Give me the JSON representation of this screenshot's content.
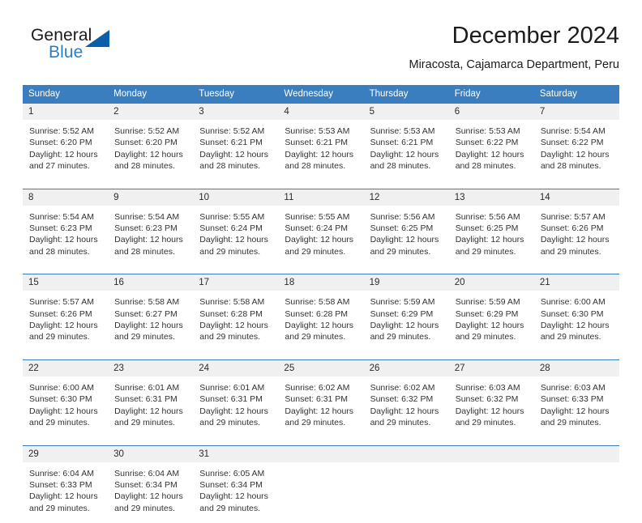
{
  "brand": {
    "name_part1": "General",
    "name_part2": "Blue",
    "flag_icon": "triangle-flag-icon"
  },
  "header": {
    "title": "December 2024",
    "subtitle": "Miracosta, Cajamarca Department, Peru"
  },
  "colors": {
    "header_blue": "#3a7ebf",
    "brand_blue": "#2e7cc4",
    "flag_blue": "#0d5ea8",
    "daynum_band": "#f0f0f0",
    "text": "#333333"
  },
  "calendar": {
    "day_headers": [
      "Sunday",
      "Monday",
      "Tuesday",
      "Wednesday",
      "Thursday",
      "Friday",
      "Saturday"
    ],
    "weeks": [
      [
        {
          "day": "1",
          "sunrise": "Sunrise: 5:52 AM",
          "sunset": "Sunset: 6:20 PM",
          "daylight_line1": "Daylight: 12 hours",
          "daylight_line2": "and 27 minutes."
        },
        {
          "day": "2",
          "sunrise": "Sunrise: 5:52 AM",
          "sunset": "Sunset: 6:20 PM",
          "daylight_line1": "Daylight: 12 hours",
          "daylight_line2": "and 28 minutes."
        },
        {
          "day": "3",
          "sunrise": "Sunrise: 5:52 AM",
          "sunset": "Sunset: 6:21 PM",
          "daylight_line1": "Daylight: 12 hours",
          "daylight_line2": "and 28 minutes."
        },
        {
          "day": "4",
          "sunrise": "Sunrise: 5:53 AM",
          "sunset": "Sunset: 6:21 PM",
          "daylight_line1": "Daylight: 12 hours",
          "daylight_line2": "and 28 minutes."
        },
        {
          "day": "5",
          "sunrise": "Sunrise: 5:53 AM",
          "sunset": "Sunset: 6:21 PM",
          "daylight_line1": "Daylight: 12 hours",
          "daylight_line2": "and 28 minutes."
        },
        {
          "day": "6",
          "sunrise": "Sunrise: 5:53 AM",
          "sunset": "Sunset: 6:22 PM",
          "daylight_line1": "Daylight: 12 hours",
          "daylight_line2": "and 28 minutes."
        },
        {
          "day": "7",
          "sunrise": "Sunrise: 5:54 AM",
          "sunset": "Sunset: 6:22 PM",
          "daylight_line1": "Daylight: 12 hours",
          "daylight_line2": "and 28 minutes."
        }
      ],
      [
        {
          "day": "8",
          "sunrise": "Sunrise: 5:54 AM",
          "sunset": "Sunset: 6:23 PM",
          "daylight_line1": "Daylight: 12 hours",
          "daylight_line2": "and 28 minutes."
        },
        {
          "day": "9",
          "sunrise": "Sunrise: 5:54 AM",
          "sunset": "Sunset: 6:23 PM",
          "daylight_line1": "Daylight: 12 hours",
          "daylight_line2": "and 28 minutes."
        },
        {
          "day": "10",
          "sunrise": "Sunrise: 5:55 AM",
          "sunset": "Sunset: 6:24 PM",
          "daylight_line1": "Daylight: 12 hours",
          "daylight_line2": "and 29 minutes."
        },
        {
          "day": "11",
          "sunrise": "Sunrise: 5:55 AM",
          "sunset": "Sunset: 6:24 PM",
          "daylight_line1": "Daylight: 12 hours",
          "daylight_line2": "and 29 minutes."
        },
        {
          "day": "12",
          "sunrise": "Sunrise: 5:56 AM",
          "sunset": "Sunset: 6:25 PM",
          "daylight_line1": "Daylight: 12 hours",
          "daylight_line2": "and 29 minutes."
        },
        {
          "day": "13",
          "sunrise": "Sunrise: 5:56 AM",
          "sunset": "Sunset: 6:25 PM",
          "daylight_line1": "Daylight: 12 hours",
          "daylight_line2": "and 29 minutes."
        },
        {
          "day": "14",
          "sunrise": "Sunrise: 5:57 AM",
          "sunset": "Sunset: 6:26 PM",
          "daylight_line1": "Daylight: 12 hours",
          "daylight_line2": "and 29 minutes."
        }
      ],
      [
        {
          "day": "15",
          "sunrise": "Sunrise: 5:57 AM",
          "sunset": "Sunset: 6:26 PM",
          "daylight_line1": "Daylight: 12 hours",
          "daylight_line2": "and 29 minutes."
        },
        {
          "day": "16",
          "sunrise": "Sunrise: 5:58 AM",
          "sunset": "Sunset: 6:27 PM",
          "daylight_line1": "Daylight: 12 hours",
          "daylight_line2": "and 29 minutes."
        },
        {
          "day": "17",
          "sunrise": "Sunrise: 5:58 AM",
          "sunset": "Sunset: 6:28 PM",
          "daylight_line1": "Daylight: 12 hours",
          "daylight_line2": "and 29 minutes."
        },
        {
          "day": "18",
          "sunrise": "Sunrise: 5:58 AM",
          "sunset": "Sunset: 6:28 PM",
          "daylight_line1": "Daylight: 12 hours",
          "daylight_line2": "and 29 minutes."
        },
        {
          "day": "19",
          "sunrise": "Sunrise: 5:59 AM",
          "sunset": "Sunset: 6:29 PM",
          "daylight_line1": "Daylight: 12 hours",
          "daylight_line2": "and 29 minutes."
        },
        {
          "day": "20",
          "sunrise": "Sunrise: 5:59 AM",
          "sunset": "Sunset: 6:29 PM",
          "daylight_line1": "Daylight: 12 hours",
          "daylight_line2": "and 29 minutes."
        },
        {
          "day": "21",
          "sunrise": "Sunrise: 6:00 AM",
          "sunset": "Sunset: 6:30 PM",
          "daylight_line1": "Daylight: 12 hours",
          "daylight_line2": "and 29 minutes."
        }
      ],
      [
        {
          "day": "22",
          "sunrise": "Sunrise: 6:00 AM",
          "sunset": "Sunset: 6:30 PM",
          "daylight_line1": "Daylight: 12 hours",
          "daylight_line2": "and 29 minutes."
        },
        {
          "day": "23",
          "sunrise": "Sunrise: 6:01 AM",
          "sunset": "Sunset: 6:31 PM",
          "daylight_line1": "Daylight: 12 hours",
          "daylight_line2": "and 29 minutes."
        },
        {
          "day": "24",
          "sunrise": "Sunrise: 6:01 AM",
          "sunset": "Sunset: 6:31 PM",
          "daylight_line1": "Daylight: 12 hours",
          "daylight_line2": "and 29 minutes."
        },
        {
          "day": "25",
          "sunrise": "Sunrise: 6:02 AM",
          "sunset": "Sunset: 6:31 PM",
          "daylight_line1": "Daylight: 12 hours",
          "daylight_line2": "and 29 minutes."
        },
        {
          "day": "26",
          "sunrise": "Sunrise: 6:02 AM",
          "sunset": "Sunset: 6:32 PM",
          "daylight_line1": "Daylight: 12 hours",
          "daylight_line2": "and 29 minutes."
        },
        {
          "day": "27",
          "sunrise": "Sunrise: 6:03 AM",
          "sunset": "Sunset: 6:32 PM",
          "daylight_line1": "Daylight: 12 hours",
          "daylight_line2": "and 29 minutes."
        },
        {
          "day": "28",
          "sunrise": "Sunrise: 6:03 AM",
          "sunset": "Sunset: 6:33 PM",
          "daylight_line1": "Daylight: 12 hours",
          "daylight_line2": "and 29 minutes."
        }
      ],
      [
        {
          "day": "29",
          "sunrise": "Sunrise: 6:04 AM",
          "sunset": "Sunset: 6:33 PM",
          "daylight_line1": "Daylight: 12 hours",
          "daylight_line2": "and 29 minutes."
        },
        {
          "day": "30",
          "sunrise": "Sunrise: 6:04 AM",
          "sunset": "Sunset: 6:34 PM",
          "daylight_line1": "Daylight: 12 hours",
          "daylight_line2": "and 29 minutes."
        },
        {
          "day": "31",
          "sunrise": "Sunrise: 6:05 AM",
          "sunset": "Sunset: 6:34 PM",
          "daylight_line1": "Daylight: 12 hours",
          "daylight_line2": "and 29 minutes."
        },
        {
          "day": "",
          "sunrise": "",
          "sunset": "",
          "daylight_line1": "",
          "daylight_line2": ""
        },
        {
          "day": "",
          "sunrise": "",
          "sunset": "",
          "daylight_line1": "",
          "daylight_line2": ""
        },
        {
          "day": "",
          "sunrise": "",
          "sunset": "",
          "daylight_line1": "",
          "daylight_line2": ""
        },
        {
          "day": "",
          "sunrise": "",
          "sunset": "",
          "daylight_line1": "",
          "daylight_line2": ""
        }
      ]
    ]
  }
}
